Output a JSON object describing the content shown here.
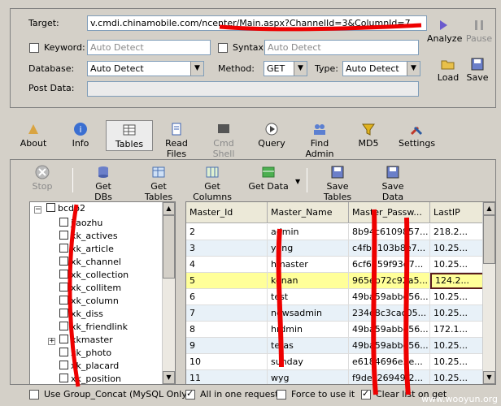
{
  "form": {
    "target_label": "Target:",
    "target_value": "v.cmdi.chinamobile.com/ncenter/Main.aspx?ChannelId=3&ColumnId=7",
    "keyword_label": "Keyword:",
    "keyword_placeholder": "Auto Detect",
    "syntax_label": "Syntax:",
    "syntax_placeholder": "Auto Detect",
    "database_label": "Database:",
    "database_value": "Auto Detect",
    "method_label": "Method:",
    "method_value": "GET",
    "type_label": "Type:",
    "type_value": "Auto Detect",
    "postdata_label": "Post Data:"
  },
  "side_buttons": {
    "analyze": "Analyze",
    "pause": "Pause",
    "load": "Load",
    "save": "Save"
  },
  "nav": [
    {
      "label": "About"
    },
    {
      "label": "Info"
    },
    {
      "label": "Tables"
    },
    {
      "label": "Read Files"
    },
    {
      "label": "Cmd Shell"
    },
    {
      "label": "Query"
    },
    {
      "label": "Find Admin"
    },
    {
      "label": "MD5"
    },
    {
      "label": "Settings"
    }
  ],
  "toolbar": [
    {
      "label": "Stop"
    },
    {
      "label": "Get DBs"
    },
    {
      "label": "Get Tables"
    },
    {
      "label": "Get Columns"
    },
    {
      "label": "Get Data"
    },
    {
      "label": "Save Tables"
    },
    {
      "label": "Save Data"
    }
  ],
  "tree": {
    "root": "bcdb2",
    "items": [
      "jiaozhu",
      "xk_actives",
      "xk_article",
      "xk_channel",
      "xk_collection",
      "xk_collitem",
      "xk_column",
      "xk_diss",
      "xk_friendlink",
      "xkmaster",
      "xk_photo",
      "xk_placard",
      "xk_position"
    ]
  },
  "grid": {
    "columns": [
      "Master_Id",
      "Master_Name",
      "Master_Passw...",
      "LastIP"
    ],
    "rows": [
      [
        "2",
        "admin",
        "8b94c6109857...",
        "218.2..."
      ],
      [
        "3",
        "yang",
        "c4fb8103b8e7...",
        "10.25..."
      ],
      [
        "4",
        "hmaster",
        "6cf6659f93d7...",
        "10.25..."
      ],
      [
        "5",
        "kenan",
        "965eb72c92a5...",
        "124.2..."
      ],
      [
        "6",
        "test",
        "49ba59abbe56...",
        "10.25..."
      ],
      [
        "7",
        "newsadmin",
        "234e8c3cac05...",
        "10.25..."
      ],
      [
        "8",
        "hrdmin",
        "49ba59abbe56...",
        "172.1..."
      ],
      [
        "9",
        "tetas",
        "49ba59abbe56...",
        "10.25..."
      ],
      [
        "10",
        "sunday",
        "e6184696e3e...",
        "10.25..."
      ],
      [
        "11",
        "wyg",
        "f9dec26949f2...",
        "10.25..."
      ]
    ]
  },
  "options": {
    "group_concat": "Use Group_Concat (MySQL Only)",
    "all_in_one": "All in one request.",
    "force_use": "Force to use it",
    "clear_list": "Clear list on get"
  },
  "watermark": "www.wooyun.org"
}
